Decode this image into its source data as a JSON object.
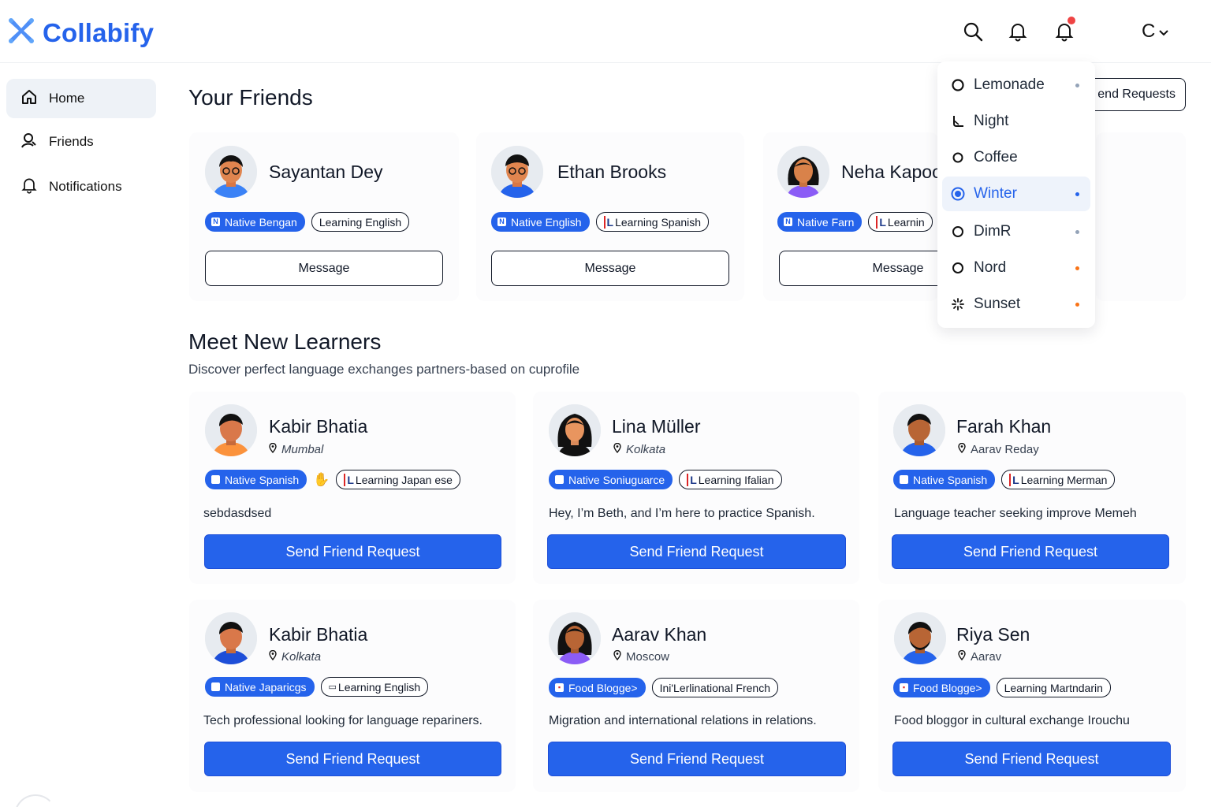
{
  "brand": {
    "name": "Collabify",
    "accent": "#2563eb"
  },
  "header": {
    "theme_letter": "C"
  },
  "sidebar": {
    "items": [
      {
        "label": "Home",
        "icon": "home-icon"
      },
      {
        "label": "Friends",
        "icon": "user-icon"
      },
      {
        "label": "Notifications",
        "icon": "bell-icon"
      }
    ]
  },
  "friends_section": {
    "title": "Your Friends",
    "requests_button": "end Requests",
    "cards": [
      {
        "name": "Sayantan Dey",
        "native": "Native Bengan",
        "learning": "Learning English",
        "button": "Message"
      },
      {
        "name": "Ethan Brooks",
        "native": "Native English",
        "learning": "Learning Spanish",
        "button": "Message"
      },
      {
        "name": "Neha Kapoo",
        "native": "Native Farn",
        "learning": "Learnin",
        "button": "Message"
      }
    ]
  },
  "learners_section": {
    "title": "Meet New Learners",
    "subtitle": "Discover perfect language exchanges partners-based on cuprofile",
    "cards": [
      {
        "name": "Kabir Bhatia",
        "location": "Mumbal",
        "native": "Native Spanish",
        "learning": "Learning Japan ese",
        "bio": "sebdasdsed",
        "button": "Send Friend Request"
      },
      {
        "name": "Lina Müller",
        "location": "Kolkata",
        "native": "Native Soniuguarce",
        "learning": "Learning Ifalian",
        "bio": "Hey, I’m Beth, and I’m here to practice Spanish.",
        "button": "Send Friend Request"
      },
      {
        "name": "Farah Khan",
        "location": "Aarav Reday",
        "native": "Native Spanish",
        "learning": "Learning Merman",
        "bio": "Language teacher seeking improve Memeh",
        "button": "Send Friend Request"
      },
      {
        "name": "Kabir Bhatia",
        "location": "Kolkata",
        "native": "Native Japaricgs",
        "learning": "Learning English",
        "bio": "Tech professional looking for language repariners.",
        "button": "Send Friend Request"
      },
      {
        "name": "Aarav Khan",
        "location": "Moscow",
        "native": "Food Blogge>",
        "learning": "Ini'Lerlinational French",
        "bio": "Migration and international relations in relations.",
        "button": "Send Friend Request"
      },
      {
        "name": "Riya Sen",
        "location": "Aarav",
        "native": "Food Blogge>",
        "learning": "Learning Martndarin",
        "bio": "Food bloggor in cultural exchange Irouchu",
        "button": "Send Friend Request"
      }
    ]
  },
  "theme_menu": {
    "items": [
      {
        "label": "Lemonade",
        "icon": "circle-icon",
        "dot": "#94a3b8"
      },
      {
        "label": "Night",
        "icon": "moon-icon",
        "dot": ""
      },
      {
        "label": "Coffee",
        "icon": "circle-icon",
        "dot": ""
      },
      {
        "label": "Winter",
        "icon": "radio-selected-icon",
        "dot": "#2563eb",
        "selected": true
      },
      {
        "label": "DimR",
        "icon": "circle-icon",
        "dot": "#94a3b8"
      },
      {
        "label": "Nord",
        "icon": "circle-icon",
        "dot": "#f97316"
      },
      {
        "label": "Sunset",
        "icon": "sparkle-icon",
        "dot": "#f97316"
      }
    ]
  }
}
